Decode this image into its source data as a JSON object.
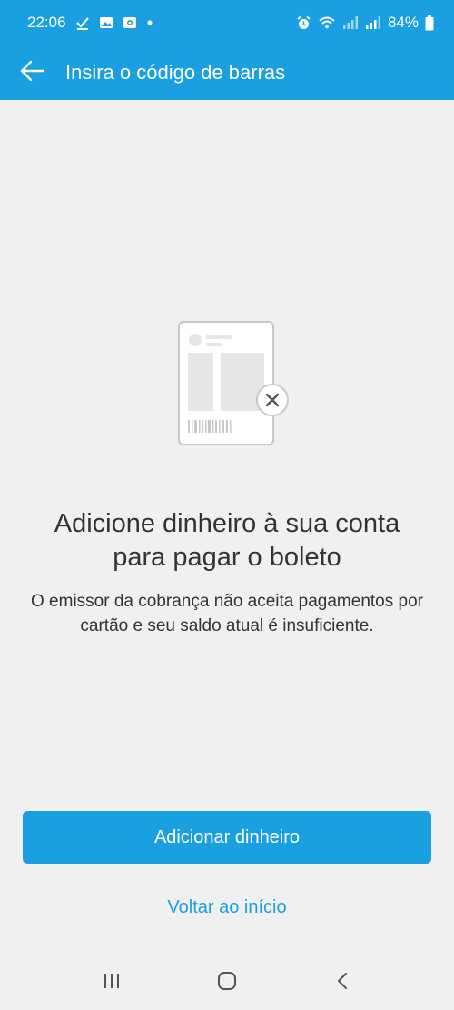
{
  "status_bar": {
    "time": "22:06",
    "battery": "84%",
    "notification_icons": [
      "check-icon",
      "image-icon",
      "camera-icon",
      "dot-icon"
    ],
    "system_icons": [
      "alarm-icon",
      "wifi-icon",
      "signal-icon",
      "signal-icon",
      "battery-icon"
    ]
  },
  "app_bar": {
    "title": "Insira o código de barras",
    "back_icon": "arrow-left-icon"
  },
  "main": {
    "illustration_icon": "boleto-error-icon",
    "headline": "Adicione dinheiro à sua conta para pagar o boleto",
    "description": "O emissor da cobrança não aceita pagamentos por cartão e seu saldo atual é insuficiente.",
    "primary_button": "Adicionar dinheiro",
    "secondary_link": "Voltar ao início"
  },
  "nav_bar": {
    "recents_icon": "recents-icon",
    "home_icon": "home-icon",
    "back_icon": "back-icon"
  },
  "colors": {
    "brand": "#1a9fe0",
    "background": "#f0f0f0",
    "text": "#333333"
  }
}
